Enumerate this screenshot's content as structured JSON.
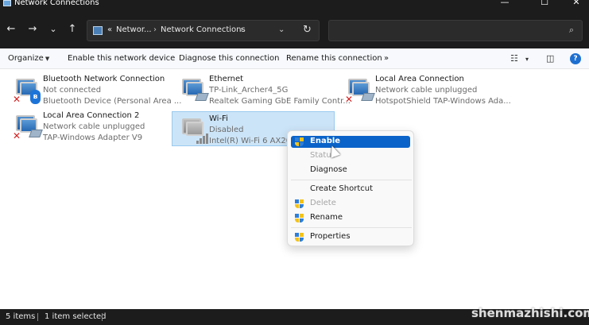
{
  "window": {
    "title": "Network Connections",
    "controls": [
      "—",
      "☐",
      "✕"
    ]
  },
  "nav": {
    "back_icon": "←",
    "forward_icon": "→",
    "recent_icon": "⌄",
    "up_icon": "↑"
  },
  "address": {
    "overflow": "«",
    "crumb1": "Networ...",
    "crumb2": "Network Connections",
    "sep": "›",
    "dropdown_icon": "⌄",
    "refresh_icon": "↻"
  },
  "search": {
    "placeholder": "",
    "icon": "⌕"
  },
  "toolbar": {
    "organize": "Organize",
    "enable": "Enable this network device",
    "diagnose": "Diagnose this connection",
    "rename": "Rename this connection",
    "more": "»",
    "view_icon": "☷",
    "view_dd": "▾",
    "preview_icon": "◫",
    "help": "?"
  },
  "connections": [
    {
      "name": "Bluetooth Network Connection",
      "status": "Not connected",
      "device": "Bluetooth Device (Personal Area ...",
      "icon": "bluetooth"
    },
    {
      "name": "Ethernet",
      "status": "TP-Link_Archer4_5G",
      "device": "Realtek Gaming GbE Family Contr...",
      "icon": "ethernet"
    },
    {
      "name": "Local Area Connection",
      "status": "Network cable unplugged",
      "device": "HotspotShield TAP-Windows Ada...",
      "icon": "lan-disconnected"
    },
    {
      "name": "Local Area Connection 2",
      "status": "Network cable unplugged",
      "device": "TAP-Windows Adapter V9",
      "icon": "lan-disconnected"
    },
    {
      "name": "Wi-Fi",
      "status": "Disabled",
      "device": "Intel(R) Wi-Fi 6 AX200",
      "icon": "wifi-disabled"
    }
  ],
  "context_menu": {
    "items": [
      {
        "label": "Enable",
        "shield": true,
        "state": "hover"
      },
      {
        "label": "Status",
        "shield": false,
        "state": "disabled"
      },
      {
        "label": "Diagnose",
        "shield": false,
        "state": "normal"
      },
      {
        "label": "Create Shortcut",
        "shield": false,
        "state": "normal"
      },
      {
        "label": "Delete",
        "shield": true,
        "state": "disabled"
      },
      {
        "label": "Rename",
        "shield": true,
        "state": "normal"
      },
      {
        "label": "Properties",
        "shield": true,
        "state": "normal"
      }
    ]
  },
  "status": {
    "items": "5 items",
    "selected": "1 item selected"
  },
  "watermark": "shenmazhishi.com",
  "colors": {
    "accent": "#0a63c9",
    "selection": "#cce4f7",
    "dark_chrome": "#1c1c1c"
  }
}
